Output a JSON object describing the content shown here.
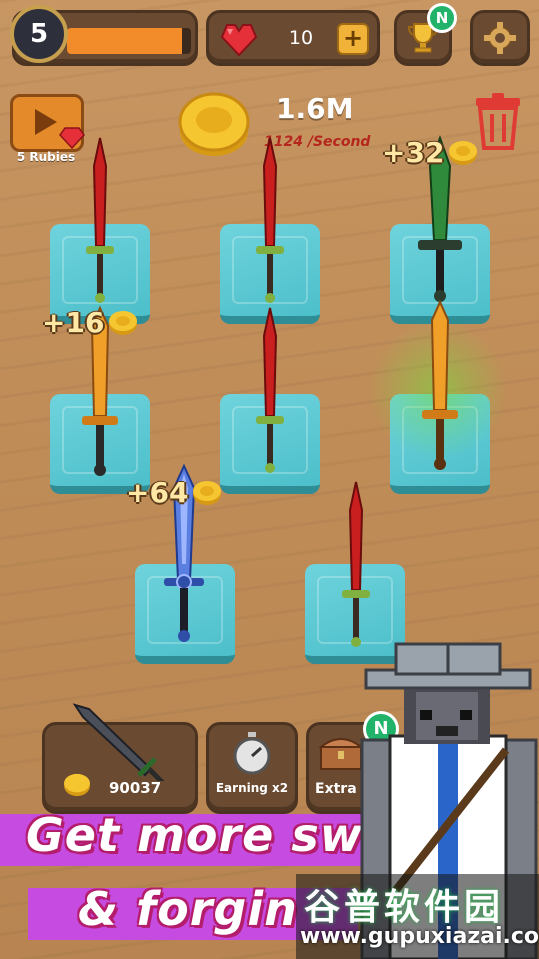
{
  "hud": {
    "level": "5",
    "level_progress": 0.93,
    "gems": "10",
    "gem_add": "+",
    "trophy_badge": "N"
  },
  "video": {
    "label": "5 Rubies"
  },
  "coins": {
    "total": "1.6M",
    "rate": "1124 /Second"
  },
  "floaters": [
    {
      "text": "+32"
    },
    {
      "text": "+16"
    },
    {
      "text": "+64"
    }
  ],
  "slots": [
    {
      "sword": "red-sword-icon"
    },
    {
      "sword": "red-sword-icon"
    },
    {
      "sword": "green-sword-icon"
    },
    {
      "sword": "gold-sword-icon"
    },
    {
      "sword": "red-sword-icon"
    },
    {
      "sword": "gold-sword-icon"
    },
    {
      "sword": "blue-sword-icon"
    },
    {
      "sword": "red-sword-icon"
    }
  ],
  "bottom": {
    "buy_price": "90037",
    "earning_label": "Earning x2",
    "extra_label": "Extra",
    "extra_badge": "N"
  },
  "promo": {
    "line1": "Get more swords",
    "line2": "& forgin"
  },
  "watermark": {
    "title": "谷普软件园",
    "url": "www.gupuxiazai.com"
  },
  "colors": {
    "accent": "#f28b2a",
    "slot": "#4cbfca",
    "banner": "#c64be0"
  }
}
